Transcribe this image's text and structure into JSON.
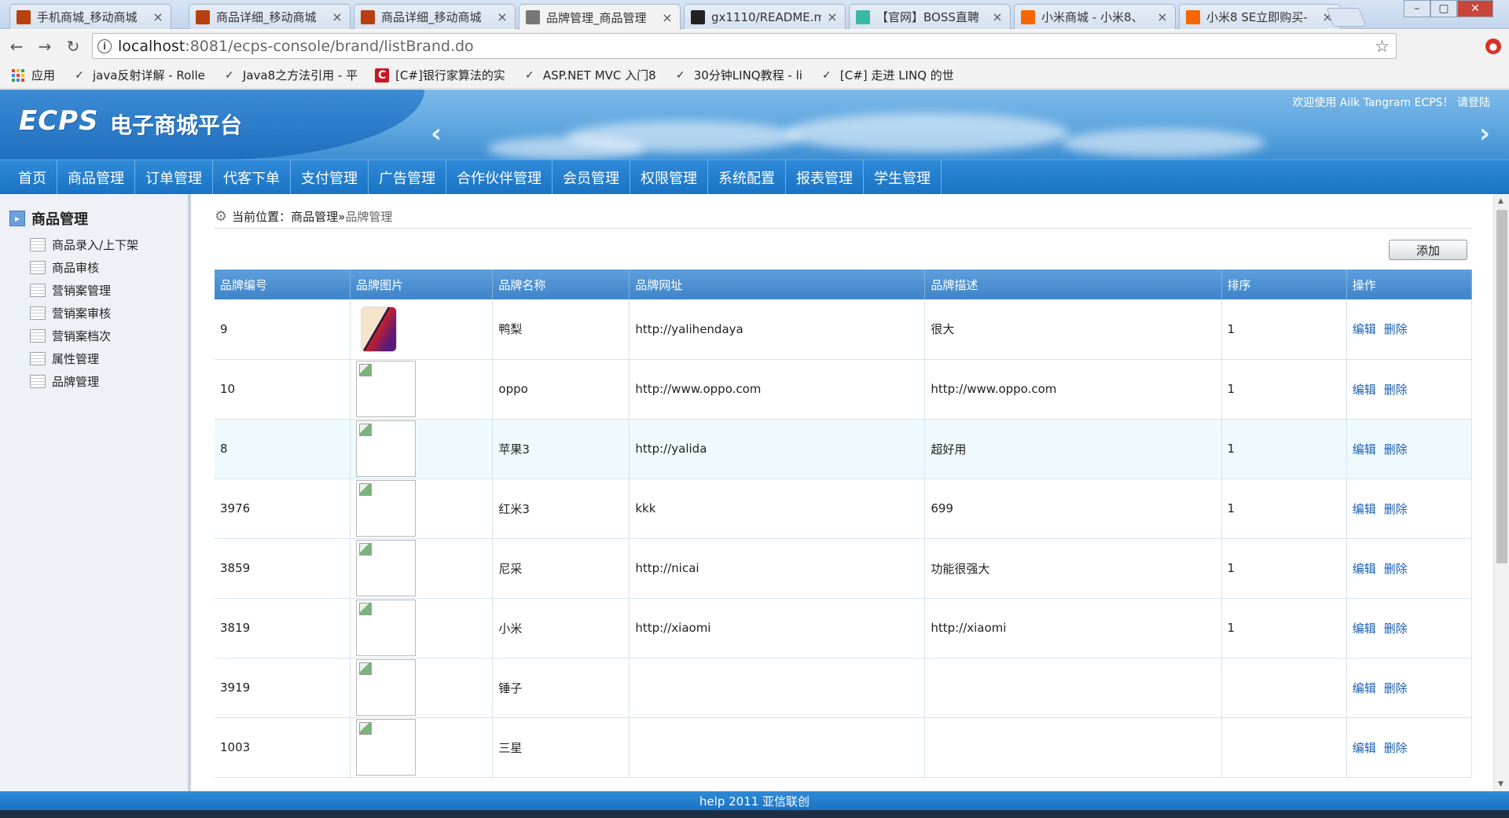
{
  "browser": {
    "tabs": [
      {
        "title": "手机商城_移动商城",
        "icon": "page-icon",
        "color": "#b7410e"
      },
      {
        "title": "商品详细_移动商城",
        "icon": "page-icon",
        "color": "#b7410e"
      },
      {
        "title": "商品详细_移动商城",
        "icon": "page-icon",
        "color": "#b7410e"
      },
      {
        "title": "品牌管理_商品管理",
        "icon": "document-icon",
        "color": "#777777"
      },
      {
        "title": "gx1110/README.m",
        "icon": "github-icon",
        "color": "#222222"
      },
      {
        "title": "【官网】BOSS直聘",
        "icon": "boss-icon",
        "color": "#3bb8a5"
      },
      {
        "title": "小米商城 - 小米8、",
        "icon": "mi-icon",
        "color": "#f56600"
      },
      {
        "title": "小米8 SE立即购买-",
        "icon": "mi-icon",
        "color": "#f56600"
      }
    ],
    "tab_close": "×",
    "url_host": "localhost",
    "url_rest": ":8081/ecps-console/brand/listBrand.do",
    "bookmarks": [
      {
        "label": "应用",
        "icon": "apps-icon"
      },
      {
        "label": "java反射详解 - Rolle",
        "icon": "bookmark-icon"
      },
      {
        "label": "Java8之方法引用 - 平",
        "icon": "bookmark-icon"
      },
      {
        "label": "[C#]银行家算法的实",
        "icon": "csdn-icon"
      },
      {
        "label": "ASP.NET MVC 入门8",
        "icon": "bookmark-icon"
      },
      {
        "label": "30分钟LINQ教程 - li",
        "icon": "bookmark-icon"
      },
      {
        "label": "[C#] 走进 LINQ 的世",
        "icon": "bookmark-icon"
      }
    ]
  },
  "header": {
    "logo": "ECPS",
    "logo_sub": "电子商城平台",
    "welcome": "欢迎使用 Ailk Tangram ECPS！ 请登陆"
  },
  "menu": [
    "首页",
    "商品管理",
    "订单管理",
    "代客下单",
    "支付管理",
    "广告管理",
    "合作伙伴管理",
    "会员管理",
    "权限管理",
    "系统配置",
    "报表管理",
    "学生管理"
  ],
  "sidebar": {
    "title": "商品管理",
    "items": [
      "商品录入/上下架",
      "商品审核",
      "营销案管理",
      "营销案审核",
      "营销案档次",
      "属性管理",
      "品牌管理"
    ]
  },
  "breadcrumb": {
    "prefix": "当前位置：",
    "parent": "商品管理",
    "sep": " » ",
    "current": "品牌管理"
  },
  "add_label": "添加",
  "table": {
    "columns": [
      "品牌编号",
      "品牌图片",
      "品牌名称",
      "品牌网址",
      "品牌描述",
      "排序",
      "操作"
    ],
    "edit_label": "编辑",
    "delete_label": "删除",
    "rows": [
      {
        "id": "9",
        "img": "phone",
        "name": "鸭梨",
        "url": "http://yalihendaya",
        "desc": "很大",
        "sort": "1"
      },
      {
        "id": "10",
        "img": "broken",
        "name": "oppo",
        "url": "http://www.oppo.com",
        "desc": "http://www.oppo.com",
        "sort": "1"
      },
      {
        "id": "8",
        "img": "broken",
        "name": "苹果3",
        "url": "http://yalida",
        "desc": "超好用",
        "sort": "1"
      },
      {
        "id": "3976",
        "img": "broken",
        "name": "红米3",
        "url": "kkk",
        "desc": "699",
        "sort": "1"
      },
      {
        "id": "3859",
        "img": "broken",
        "name": "尼采",
        "url": "http://nicai",
        "desc": "功能很强大",
        "sort": "1"
      },
      {
        "id": "3819",
        "img": "broken",
        "name": "小米",
        "url": "http://xiaomi",
        "desc": "http://xiaomi",
        "sort": "1"
      },
      {
        "id": "3919",
        "img": "broken",
        "name": "锤子",
        "url": "",
        "desc": "",
        "sort": ""
      },
      {
        "id": "1003",
        "img": "broken",
        "name": "三星",
        "url": "",
        "desc": "",
        "sort": ""
      }
    ]
  },
  "footer": "help 2011 亚信联创"
}
